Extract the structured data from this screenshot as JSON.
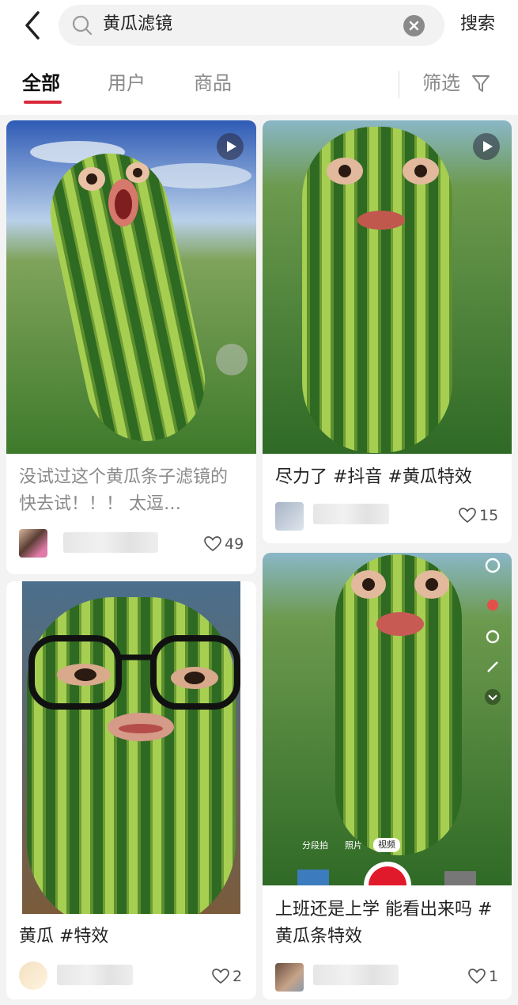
{
  "header": {
    "query": "黄瓜滤镜",
    "search_label": "搜索"
  },
  "tabs": [
    {
      "label": "全部",
      "active": true
    },
    {
      "label": "用户",
      "active": false
    },
    {
      "label": "商品",
      "active": false
    }
  ],
  "filter_label": "筛选",
  "feed": [
    {
      "caption": "没试过这个黄瓜条子滤镜的 快去试！！！ 太逗…",
      "likes": "49",
      "is_video": true
    },
    {
      "caption": "尽力了 #抖音 #黄瓜特效",
      "likes": "15",
      "is_video": true
    },
    {
      "caption": "黄瓜 #特效",
      "likes": "2",
      "is_video": false
    },
    {
      "caption": "上班还是上学 能看出来吗 #黄瓜条特效",
      "likes": "1",
      "is_video": false,
      "camera_modes": [
        "分段拍",
        "照片",
        "视频"
      ],
      "active_mode": "视频"
    }
  ],
  "colors": {
    "accent": "#d9283a",
    "melon_dark": "#2f6b22",
    "melon_light": "#a8d255"
  }
}
